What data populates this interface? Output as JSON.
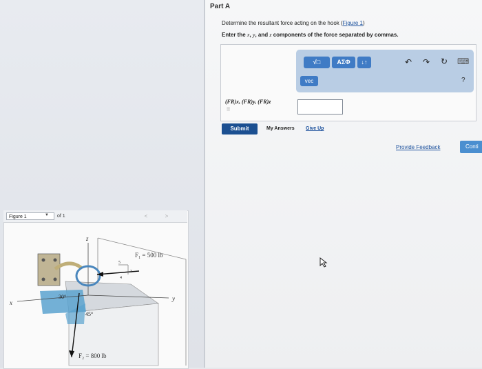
{
  "part": {
    "title": "Part A"
  },
  "question": {
    "text": "Determine the resultant force acting on the hook (",
    "link": "Figure 1",
    "end": ")"
  },
  "instruction": {
    "p1": "Enter the ",
    "x": "x",
    "p2": ", ",
    "y": "y",
    "p3": ", and ",
    "z": "z",
    "p4": " components of the force separated by commas."
  },
  "toolbar": {
    "template_label": "√□",
    "symbols_label": "AΣΦ",
    "arrows_label": "↓↑",
    "undo_icon": "↶",
    "redo_icon": "↷",
    "reset_icon": "↻",
    "keyboard_icon": "⌨",
    "vec_label": "vec",
    "help_label": "?"
  },
  "answer": {
    "components_label": "(FR)x, (FR)y, (FR)z",
    "equals": "=",
    "value": ""
  },
  "actions": {
    "submit_label": "Submit",
    "my_answers_label": "My Answers",
    "give_up_label": "Give Up",
    "feedback_label": "Provide Feedback",
    "continue_label": "Conti"
  },
  "figure": {
    "selected": "Figure 1",
    "of_label": "of 1",
    "prev": "<",
    "next": ">",
    "labels": {
      "z_axis": "z",
      "x_axis": "x",
      "y_axis": "y",
      "f1": "F₁ = 500 lb",
      "f2": "F₂ = 800 lb",
      "angle30": "30°",
      "angle45": "45°",
      "slope5": "5",
      "slope4": "4",
      "slope3": "3"
    }
  }
}
